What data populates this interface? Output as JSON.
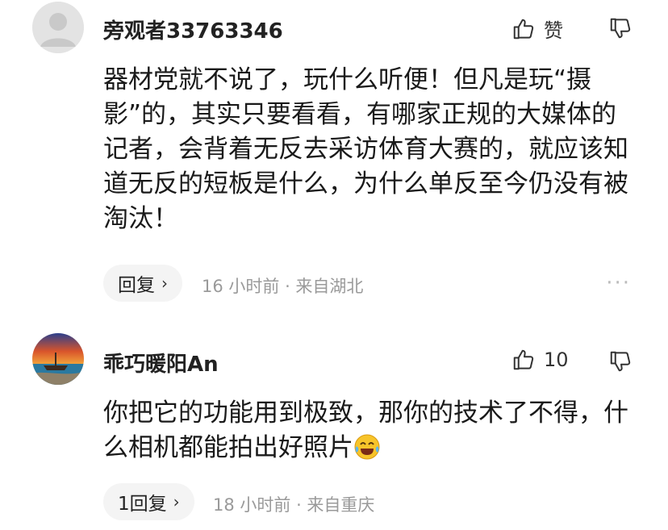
{
  "comments": [
    {
      "username": "旁观者33763346",
      "like_label": "赞",
      "body": "器材党就不说了，玩什么听便！但凡是玩“摄影”的，其实只要看看，有哪家正规的大媒体的记者，会背着无反去采访体育大赛的，就应该知道无反的短板是什么，为什么单反至今仍没有被淘汰！",
      "reply_label": "回复",
      "meta": "16 小时前 · 来自湖北",
      "more": "···",
      "avatar_icon": "default-avatar-icon"
    },
    {
      "username": "乖巧暖阳An",
      "like_label": "10",
      "body": "你把它的功能用到极致，那你的技术了不得，什么相机都能拍出好照片",
      "emoji": "laughing-tears-emoji",
      "reply_label": "1回复",
      "meta": "18 小时前 · 来自重庆",
      "avatar_icon": "sunset-boat-painting-avatar"
    }
  ]
}
